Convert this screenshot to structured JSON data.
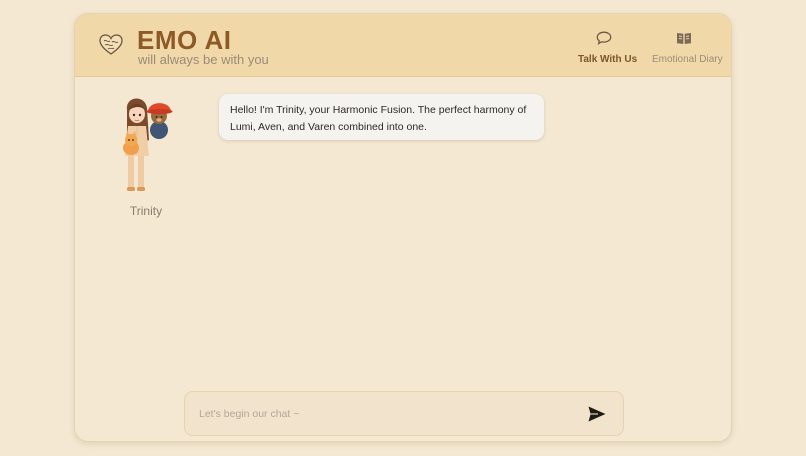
{
  "header": {
    "title": "EMO AI",
    "tagline": "will always be with you",
    "nav": [
      {
        "label": "Talk With Us",
        "icon": "chat-bubble-icon",
        "active": true
      },
      {
        "label": "Emotional Diary",
        "icon": "book-icon",
        "active": false
      }
    ]
  },
  "chat": {
    "assistant_name": "Trinity",
    "messages": [
      {
        "sender": "Trinity",
        "text": "Hello! I'm Trinity, your Harmonic Fusion. The perfect harmony of Lumi, Aven, and Varen combined into one."
      }
    ]
  },
  "composer": {
    "placeholder": "Let's begin our chat ~",
    "value": ""
  },
  "colors": {
    "background": "#f4e8d3",
    "header": "#f1d8a9",
    "brand": "#8d5a26",
    "bubble": "#f5f3ef"
  }
}
